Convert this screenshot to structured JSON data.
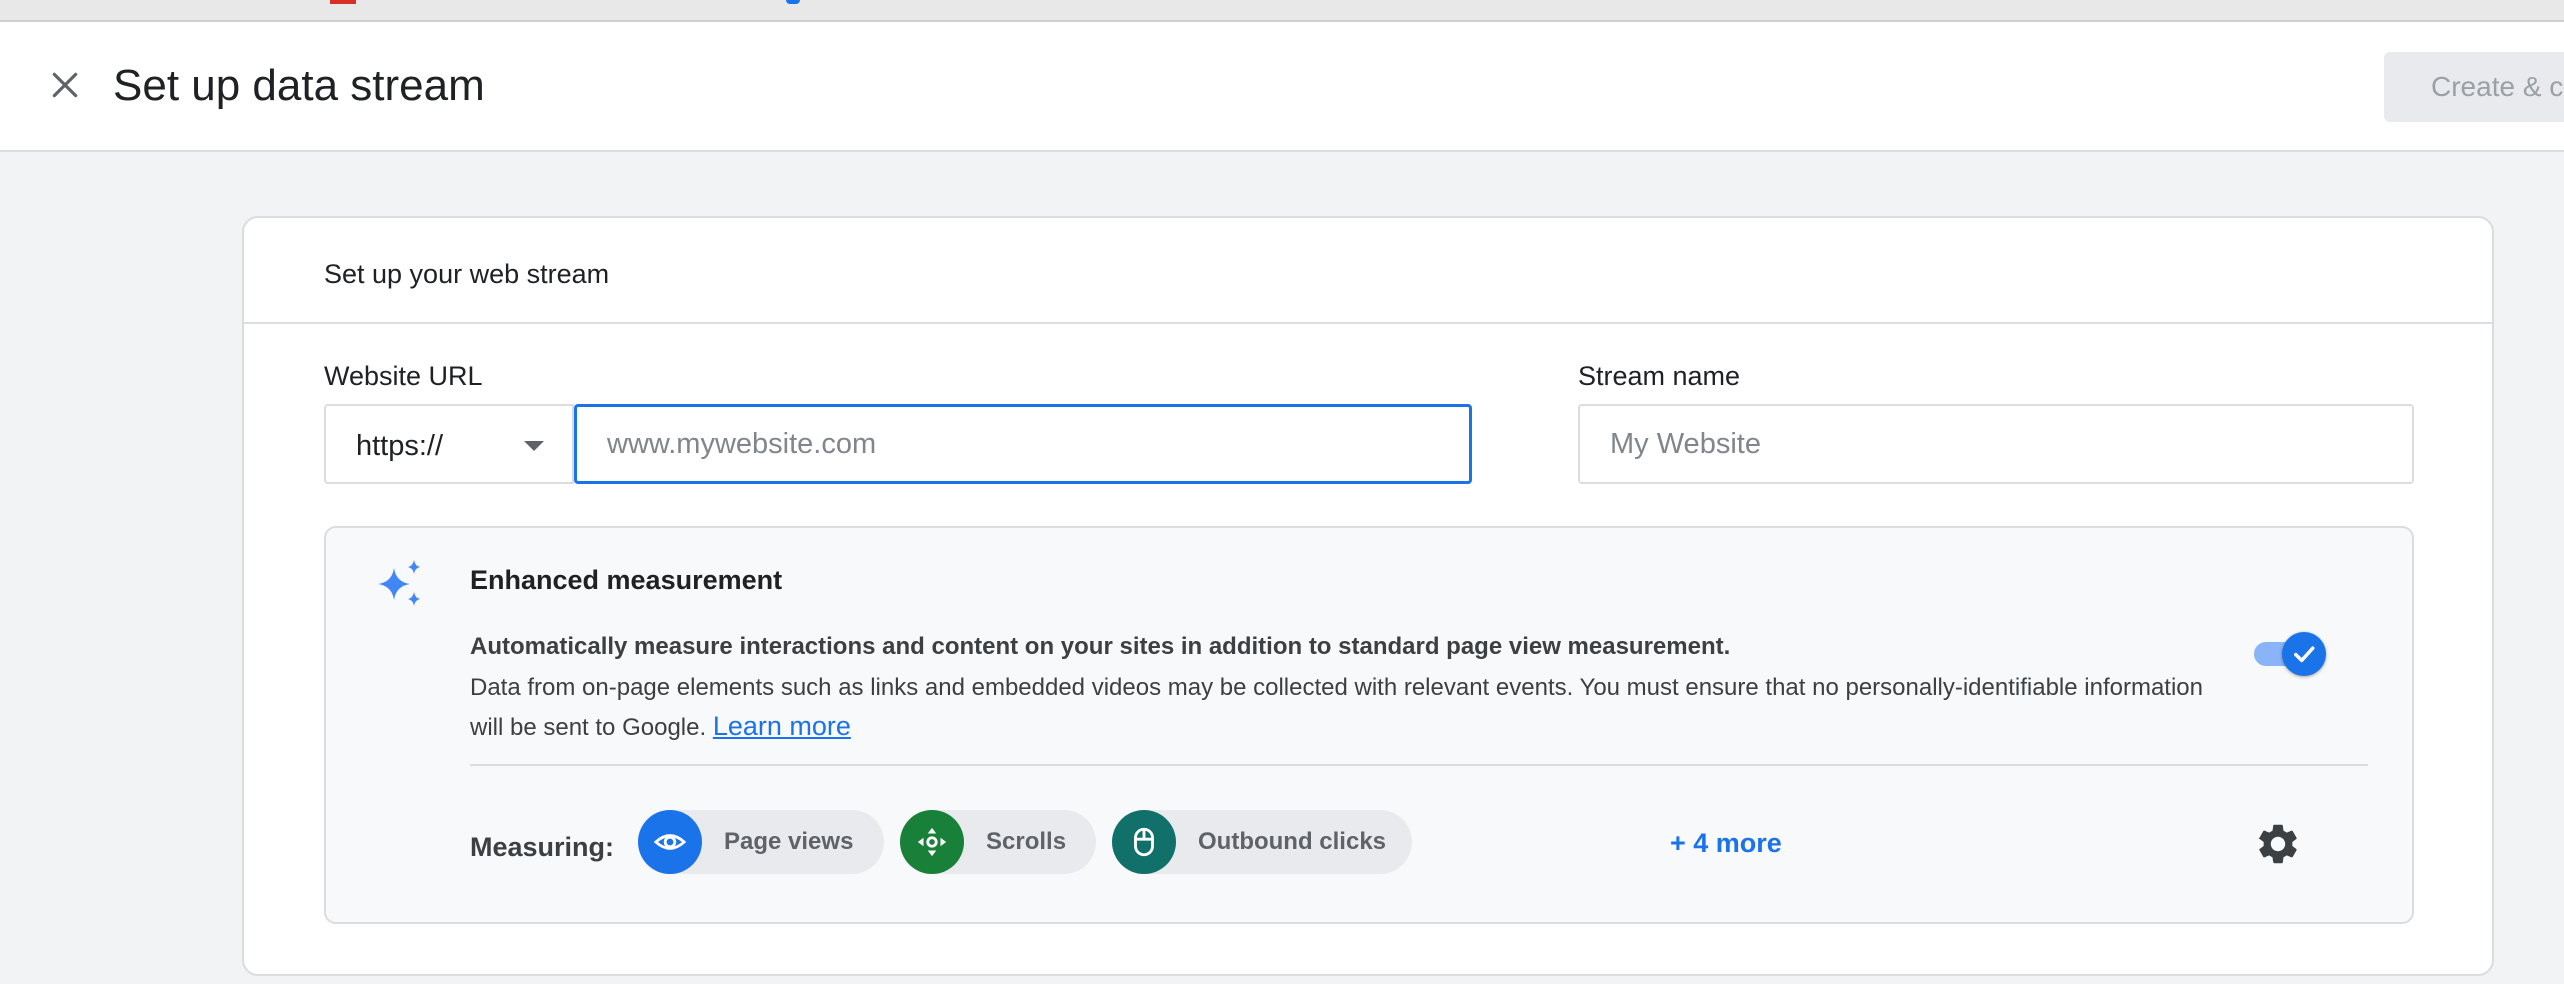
{
  "header": {
    "title": "Set up data stream",
    "create_button_label": "Create & c"
  },
  "card": {
    "title": "Set up your web stream"
  },
  "website_url": {
    "label": "Website URL",
    "protocol": "https://",
    "placeholder": "www.mywebsite.com",
    "value": ""
  },
  "stream_name": {
    "label": "Stream name",
    "placeholder": "My Website",
    "value": ""
  },
  "enhanced_measurement": {
    "title": "Enhanced measurement",
    "description_bold": "Automatically measure interactions and content on your sites in addition to standard page view measurement.",
    "description": "Data from on-page elements such as links and embedded videos may be collected with relevant events. You must ensure that no personally-identifiable information will be sent to Google.",
    "learn_more": "Learn more",
    "enabled": true,
    "measuring_label": "Measuring:",
    "chips": [
      {
        "label": "Page views",
        "icon": "eye-icon",
        "color": "#1a73e8"
      },
      {
        "label": "Scrolls",
        "icon": "scroll-arrows-icon",
        "color": "#188038"
      },
      {
        "label": "Outbound clicks",
        "icon": "mouse-icon",
        "color": "#12706b"
      }
    ],
    "more_link": "+ 4 more"
  },
  "colors": {
    "accent": "#1a73e8",
    "toggle_track": "#8ab4f8",
    "page_views": "#1a73e8",
    "scrolls": "#188038",
    "outbound_clicks": "#12706b",
    "border": "#dadce0",
    "disabled_button": "#e8eaed"
  }
}
